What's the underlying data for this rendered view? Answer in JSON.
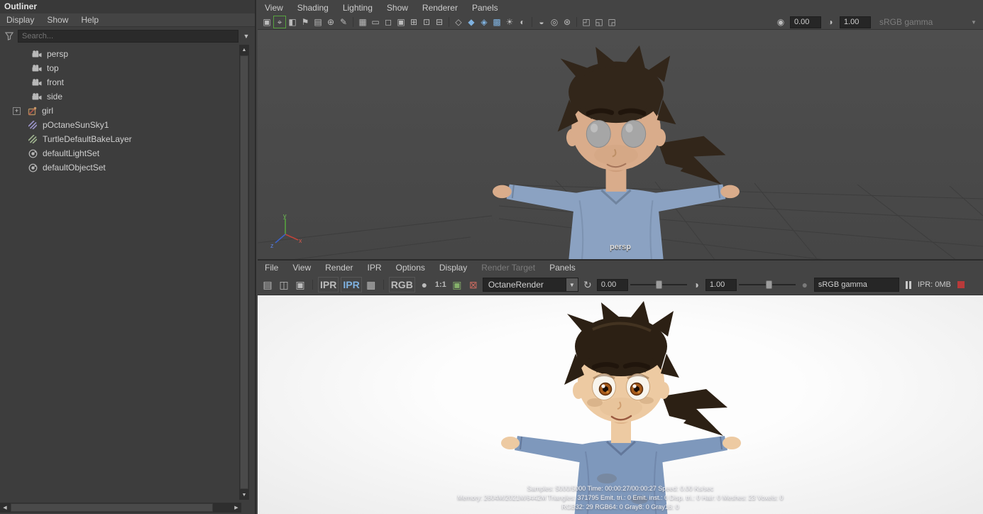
{
  "ui": {
    "icons": {
      "down_arrow": "▼",
      "up_arrow": "▲",
      "left_arrow": "◀",
      "right_arrow": "▶"
    }
  },
  "outliner": {
    "title": "Outliner",
    "menus": [
      "Display",
      "Show",
      "Help"
    ],
    "search_placeholder": "Search...",
    "items": [
      {
        "label": "persp",
        "icon": "camera-icon"
      },
      {
        "label": "top",
        "icon": "camera-icon"
      },
      {
        "label": "front",
        "icon": "camera-icon"
      },
      {
        "label": "side",
        "icon": "camera-icon"
      },
      {
        "label": "girl",
        "icon": "transform-group-icon",
        "expander": "+"
      },
      {
        "label": "pOctaneSunSky1",
        "icon": "sun-sky-icon"
      },
      {
        "label": "TurtleDefaultBakeLayer",
        "icon": "bake-layer-icon"
      },
      {
        "label": "defaultLightSet",
        "icon": "light-set-icon"
      },
      {
        "label": "defaultObjectSet",
        "icon": "object-set-icon"
      }
    ]
  },
  "viewport": {
    "menus": [
      "View",
      "Shading",
      "Lighting",
      "Show",
      "Renderer",
      "Panels"
    ],
    "camera_label": "persp",
    "exposure": "0.00",
    "gamma": "1.00",
    "view_transform": "sRGB gamma",
    "axis": {
      "x": "x",
      "y": "y",
      "z": "z"
    },
    "toolbar_icons": [
      {
        "name": "select-camera-icon",
        "glyph": "▣"
      },
      {
        "name": "camera-lock-icon",
        "glyph": "⌖"
      },
      {
        "name": "camera-attributes-icon",
        "glyph": "◧"
      },
      {
        "name": "bookmark-icon",
        "glyph": "⚑"
      },
      {
        "name": "image-plane-icon",
        "glyph": "▤"
      },
      {
        "name": "pan-zoom-icon",
        "glyph": "⊕"
      },
      {
        "name": "grease-pencil-icon",
        "glyph": "✎"
      },
      {
        "name": "grid-icon",
        "glyph": "▦"
      },
      {
        "name": "film-gate-icon",
        "glyph": "▭"
      },
      {
        "name": "resolution-gate-icon",
        "glyph": "◻"
      },
      {
        "name": "gate-mask-icon",
        "glyph": "▣"
      },
      {
        "name": "field-chart-icon",
        "glyph": "⊞"
      },
      {
        "name": "safe-action-icon",
        "glyph": "⊡"
      },
      {
        "name": "safe-title-icon",
        "glyph": "⊟"
      },
      {
        "name": "wireframe-icon",
        "glyph": "◇"
      },
      {
        "name": "shaded-icon",
        "glyph": "◆"
      },
      {
        "name": "textured-icon",
        "glyph": "◈"
      },
      {
        "name": "checker-icon",
        "glyph": "▩"
      },
      {
        "name": "lights-icon",
        "glyph": "☀"
      },
      {
        "name": "shadows-icon",
        "glyph": "◐"
      },
      {
        "name": "ao-icon",
        "glyph": "◒"
      },
      {
        "name": "motion-blur-icon",
        "glyph": "◎"
      },
      {
        "name": "multisample-icon",
        "glyph": "⊛"
      },
      {
        "name": "isolate-select-icon",
        "glyph": "◰"
      },
      {
        "name": "xray-icon",
        "glyph": "◱"
      },
      {
        "name": "joint-xray-icon",
        "glyph": "◲"
      },
      {
        "name": "exposure-icon",
        "glyph": "◉"
      },
      {
        "name": "gamma-icon",
        "glyph": "◑"
      }
    ]
  },
  "render_view": {
    "menus": [
      "File",
      "View",
      "Render",
      "IPR",
      "Options",
      "Display",
      "Render Target",
      "Panels"
    ],
    "renderer": "OctaneRender",
    "exposure": "0.00",
    "gamma": "1.00",
    "color_space": "sRGB gamma",
    "ipr_memory": "IPR: 0MB",
    "toolbar_icons": [
      {
        "name": "render-icon",
        "glyph": "▤"
      },
      {
        "name": "ipr-render-icon",
        "glyph": "◫"
      },
      {
        "name": "snapshot-icon",
        "glyph": "▣"
      },
      {
        "name": "ipr-tuning-icon",
        "glyph": "IPR"
      },
      {
        "name": "ipr-refresh-icon",
        "glyph": "IPR"
      },
      {
        "name": "render-settings-icon",
        "glyph": "▦"
      },
      {
        "name": "rgb-channels-label",
        "glyph": "RGB"
      },
      {
        "name": "alpha-channel-icon",
        "glyph": "●"
      },
      {
        "name": "zoom-ratio-label",
        "glyph": "1:1"
      },
      {
        "name": "keep-image-icon",
        "glyph": "▣"
      },
      {
        "name": "remove-image-icon",
        "glyph": "⊠"
      },
      {
        "name": "octane-restart-icon",
        "glyph": "↻"
      },
      {
        "name": "contrast-icon",
        "glyph": "◑"
      },
      {
        "name": "region-dot-icon",
        "glyph": "●"
      }
    ],
    "status": {
      "line1": "Samples: 5000/5000 Time: 00:00:27/00:00:27 Speed: 0.00 Ks/sec",
      "line2": "Memory: 2604M/2021M/6442M Triangles: 371795 Emit. tri.: 0 Emit. inst.: 0 Disp. tri.: 0 Hair: 0 Meshes: 23 Voxels: 0",
      "line3": "RGB32: 29 RGB64: 0 Gray8: 0 Gray16: 0"
    }
  }
}
